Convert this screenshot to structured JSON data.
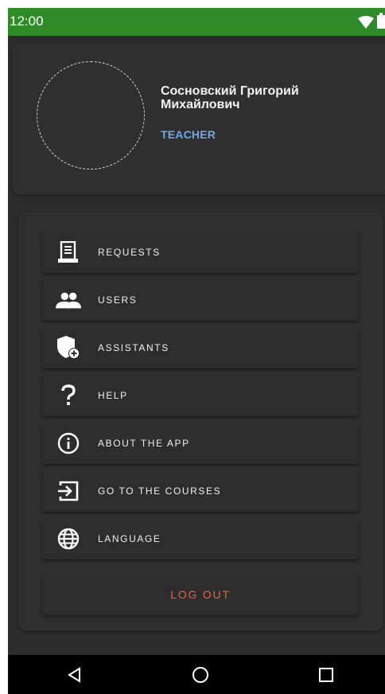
{
  "status_bar": {
    "time": "12:00",
    "wifi_icon": "wifi-icon",
    "battery_icon": "battery-icon"
  },
  "profile": {
    "name": "Сосновский Григорий Михайлович",
    "role": "TEACHER",
    "role_color": "#6ea8e8"
  },
  "menu": {
    "items": [
      {
        "label": "REQUESTS",
        "icon": "requests-document-icon"
      },
      {
        "label": "USERS",
        "icon": "users-icon"
      },
      {
        "label": "ASSISTANTS",
        "icon": "shield-add-icon"
      },
      {
        "label": "HELP",
        "icon": "question-mark-icon"
      },
      {
        "label": "ABOUT THE APP",
        "icon": "info-icon"
      },
      {
        "label": "GO TO THE COURSES",
        "icon": "login-arrow-icon"
      },
      {
        "label": "LANGUAGE",
        "icon": "globe-icon"
      }
    ],
    "logout_label": "LOG OUT",
    "logout_color": "#e8643a"
  },
  "nav_bar": {
    "back_icon": "back-triangle-icon",
    "home_icon": "home-circle-icon",
    "recents_icon": "recents-square-icon"
  },
  "colors": {
    "status_bar": "#2e8b28",
    "background": "#2c2c2c",
    "card": "#2f2f2f"
  }
}
